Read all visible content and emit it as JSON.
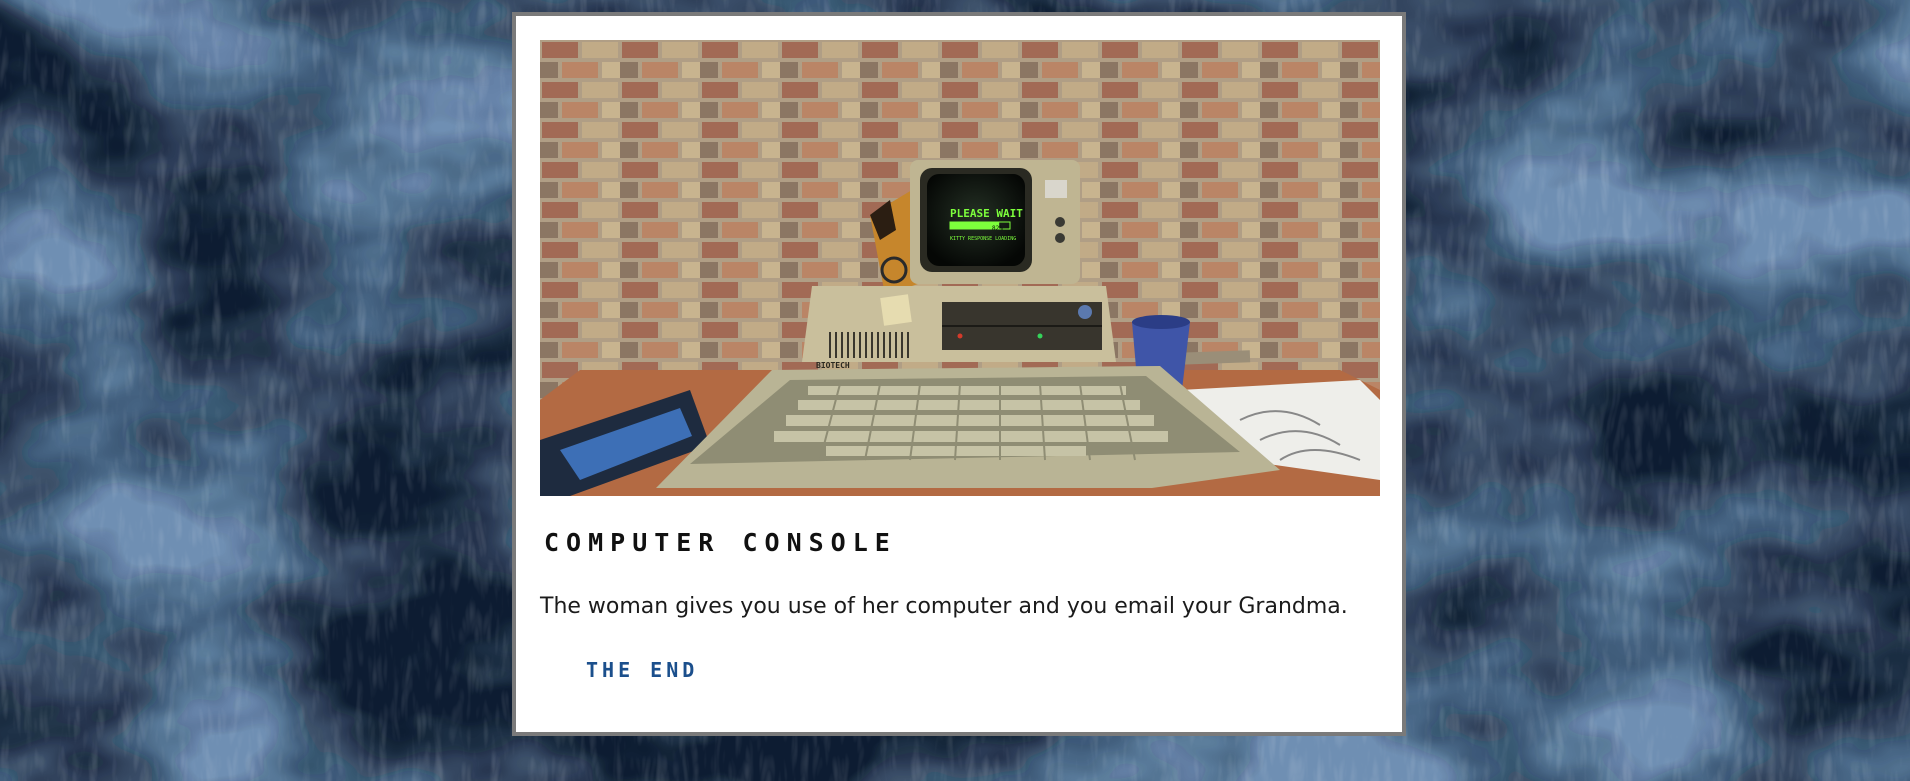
{
  "page": {
    "title": "Computer Console",
    "text": "The woman gives you use of her computer and you email your Grandma.",
    "choices": [
      {
        "label": "THE END"
      }
    ]
  },
  "scene": {
    "monitor_line1": "PLEASE WAIT",
    "monitor_percent": "82%",
    "monitor_line2": "KITTY RESPONSE LOADING",
    "brand_label": "BIOTECH",
    "loading_progress": 0.82,
    "monitor_text_color": "#7dff3c"
  },
  "colors": {
    "panel_border": "#7a7a7a",
    "title": "#111111",
    "body_text": "#1b1b1b",
    "choice_link": "#1b4f8c"
  }
}
